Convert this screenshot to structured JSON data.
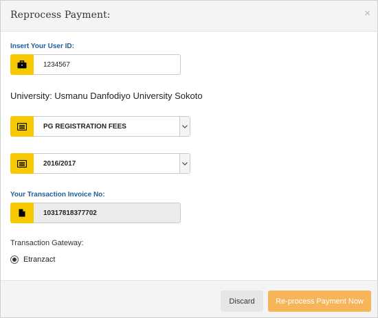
{
  "modal": {
    "title": "Reprocess Payment:",
    "close_glyph": "×"
  },
  "user_id": {
    "label": "Insert Your User ID:",
    "value": "1234567",
    "icon": "briefcase-icon"
  },
  "university_text": "University: Usmanu Danfodiyo University Sokoto",
  "fee_select": {
    "selected": "PG REGISTRATION FEES",
    "icon": "list-icon"
  },
  "session_select": {
    "selected": "2016/2017",
    "icon": "list-icon"
  },
  "invoice": {
    "label": "Your Transaction Invoice No:",
    "value": "10317818377702",
    "icon": "document-icon"
  },
  "gateway": {
    "label": "Transaction Gateway:",
    "options": [
      {
        "label": "Etranzact",
        "checked": true
      }
    ]
  },
  "footer": {
    "discard_label": "Discard",
    "submit_label": "Re-process Payment Now"
  },
  "colors": {
    "addon_yellow": "#f7c900",
    "label_blue": "#1c5e9a",
    "primary_orange": "#f7b55a"
  }
}
